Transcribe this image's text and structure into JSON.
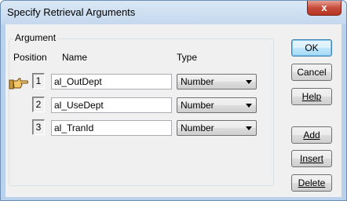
{
  "window": {
    "title": "Specify Retrieval Arguments",
    "close_glyph": "x"
  },
  "group": {
    "label": "Argument"
  },
  "columns": {
    "position": "Position",
    "name": "Name",
    "type": "Type"
  },
  "rows": [
    {
      "position": "1",
      "name": "al_OutDept",
      "type": "Number"
    },
    {
      "position": "2",
      "name": "al_UseDept",
      "type": "Number"
    },
    {
      "position": "3",
      "name": "al_TranId",
      "type": "Number"
    }
  ],
  "buttons": {
    "ok": "OK",
    "cancel": "Cancel",
    "help": "Help",
    "add": "Add",
    "insert": "Insert",
    "delete": "Delete"
  },
  "icons": {
    "row_pointer": "pointing-hand-icon",
    "dropdown": "chevron-down-icon"
  }
}
